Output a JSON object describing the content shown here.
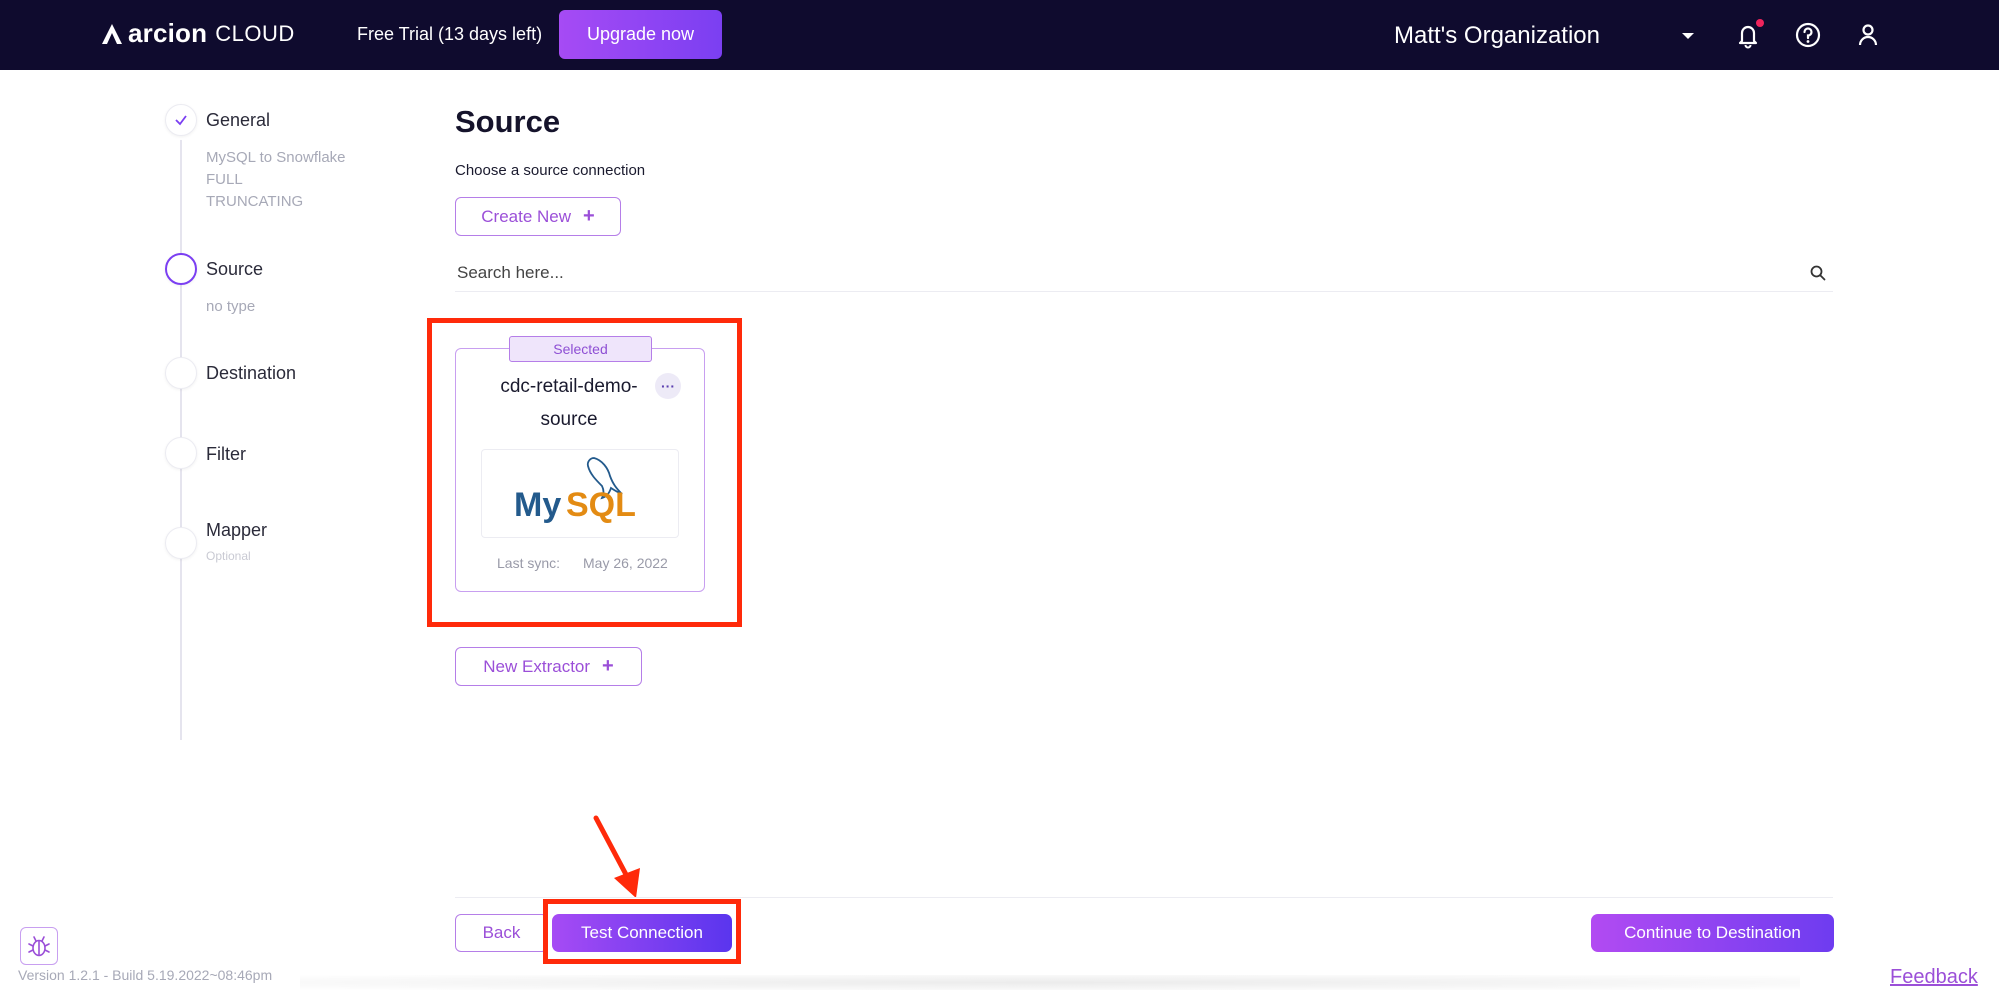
{
  "header": {
    "brand": "arcion",
    "brand_suffix": "CLOUD",
    "trial_text": "Free Trial (13 days left)",
    "upgrade_label": "Upgrade now",
    "organization": "Matt's Organization"
  },
  "steps": [
    {
      "label": "General",
      "details": [
        "MySQL to Snowflake",
        "FULL",
        "TRUNCATING"
      ],
      "status": "done"
    },
    {
      "label": "Source",
      "details": [
        "no type"
      ],
      "status": "active"
    },
    {
      "label": "Destination",
      "details": [],
      "status": "pending"
    },
    {
      "label": "Filter",
      "details": [],
      "status": "pending"
    },
    {
      "label": "Mapper",
      "details": [],
      "optional_text": "Optional",
      "status": "pending"
    }
  ],
  "main": {
    "title": "Source",
    "subtitle": "Choose a source connection",
    "create_new_label": "Create New",
    "search_placeholder": "Search here...",
    "card": {
      "selected_label": "Selected",
      "name_line1": "cdc-retail-demo-",
      "name_line2": "source",
      "more_label": "···",
      "logo_text_my": "My",
      "logo_text_sql": "SQL",
      "last_sync_label": "Last sync:",
      "last_sync_value": "May 26, 2022"
    },
    "new_extractor_label": "New Extractor"
  },
  "footer": {
    "back_label": "Back",
    "test_connection_label": "Test Connection",
    "continue_label": "Continue to Destination",
    "version": "Version 1.2.1 - Build 5.19.2022~08:46pm",
    "feedback": "Feedback"
  },
  "colors": {
    "topbar": "#0f0b2e",
    "accent": "#9b4fd8",
    "annotation": "#ff2a0a"
  }
}
